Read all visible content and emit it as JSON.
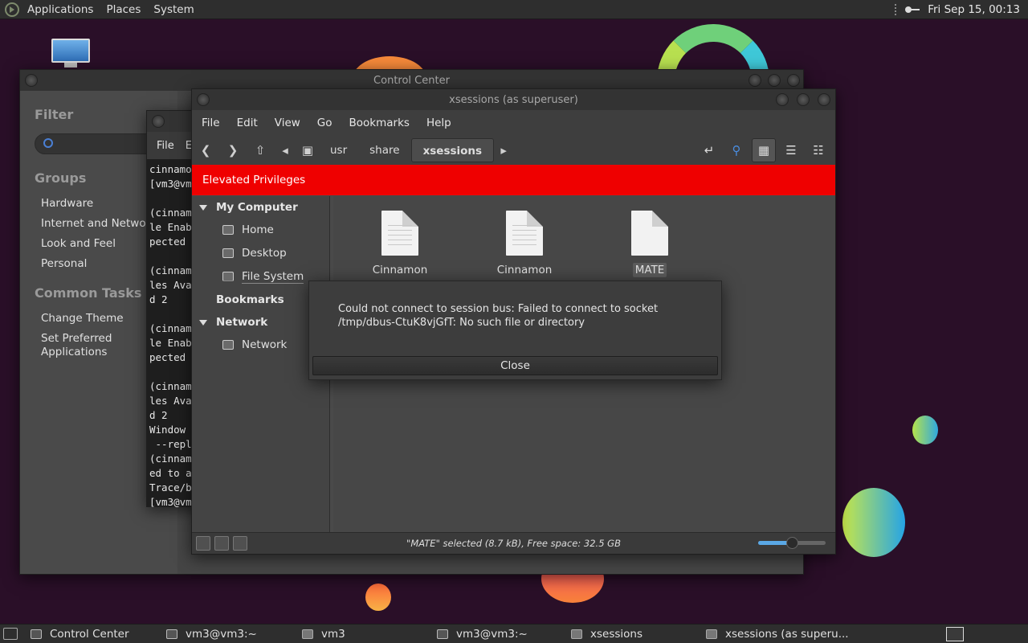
{
  "top_panel": {
    "menus": [
      "Applications",
      "Places",
      "System"
    ],
    "clock": "Fri Sep 15, 00:13"
  },
  "control_center": {
    "title": "Control Center",
    "filter_heading": "Filter",
    "groups_heading": "Groups",
    "groups": [
      "Hardware",
      "Internet and Network",
      "Look and Feel",
      "Personal"
    ],
    "tasks_heading": "Common Tasks",
    "tasks": [
      "Change Theme",
      "Set Preferred Applications"
    ]
  },
  "terminal": {
    "menu_file": "File",
    "menu_edit": "E",
    "lines": [
      "cinnamo",
      "[vm3@vm",
      "",
      "(cinnam",
      "le Enab",
      "pected ",
      "",
      "(cinnam",
      "les Ava",
      "d 2",
      "",
      "(cinnam",
      "le Enab",
      "pected ",
      "",
      "(cinnam",
      "les Ava",
      "d 2",
      "Window ",
      " --repl",
      "(cinnam",
      "ed to a",
      "Trace/b",
      "[vm3@vm"
    ]
  },
  "file_manager": {
    "title": "xsessions (as superuser)",
    "menus": [
      "File",
      "Edit",
      "View",
      "Go",
      "Bookmarks",
      "Help"
    ],
    "breadcrumbs": [
      "usr",
      "share",
      "xsessions"
    ],
    "banner": "Elevated Privileges",
    "sidebar": {
      "my_computer": "My Computer",
      "places": [
        "Home",
        "Desktop",
        "File System"
      ],
      "bookmarks": "Bookmarks",
      "network_heading": "Network",
      "network_item": "Network"
    },
    "files": [
      {
        "name": "Cinnamon"
      },
      {
        "name": "Cinnamon"
      },
      {
        "name": "MATE",
        "selected": true
      }
    ],
    "status": "\"MATE\" selected (8.7 kB), Free space: 32.5 GB",
    "zoom_level": 0.5
  },
  "error_dialog": {
    "message": "Could not connect to session bus: Failed to connect to socket /tmp/dbus-CtuK8vjGfT: No such file or directory",
    "close_label": "Close"
  },
  "taskbar": {
    "items": [
      "Control Center",
      "vm3@vm3:~",
      "vm3",
      "vm3@vm3:~",
      "xsessions",
      "xsessions (as superu..."
    ]
  }
}
